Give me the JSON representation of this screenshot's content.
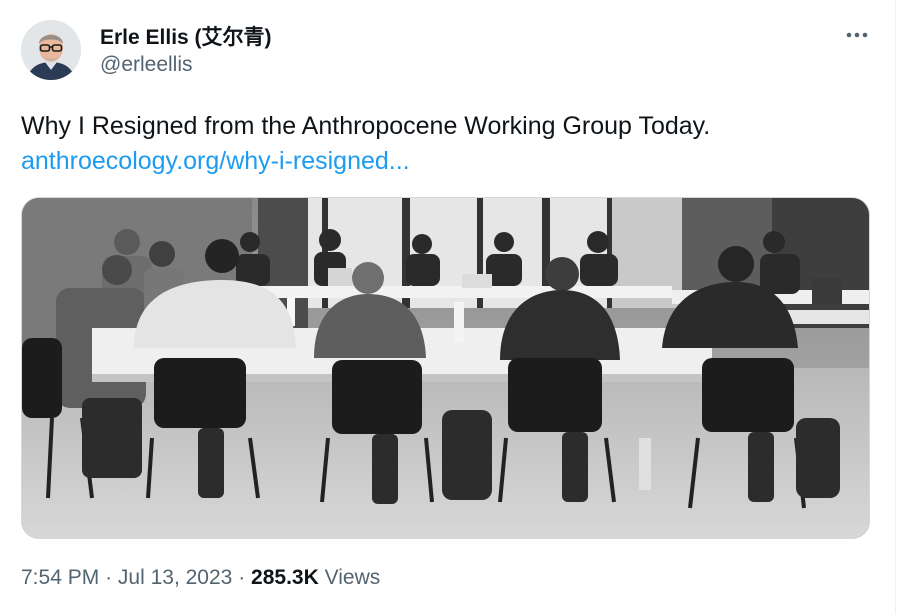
{
  "author": {
    "name": "Erle Ellis (艾尔青)",
    "handle": "@erleellis"
  },
  "tweet": {
    "text": "Why I Resigned from the Anthropocene Working Group Today.",
    "link": "anthroecology.org/why-i-resigned..."
  },
  "meta": {
    "time": "7:54 PM",
    "separator": "·",
    "date": "Jul 13, 2023",
    "views_count": "285.3K",
    "views_label": "Views"
  },
  "icons": {
    "more": "more-horizontal-icon"
  },
  "colors": {
    "text_primary": "#0f1419",
    "text_secondary": "#536471",
    "link": "#1d9bf0",
    "border": "#cfd9de"
  }
}
